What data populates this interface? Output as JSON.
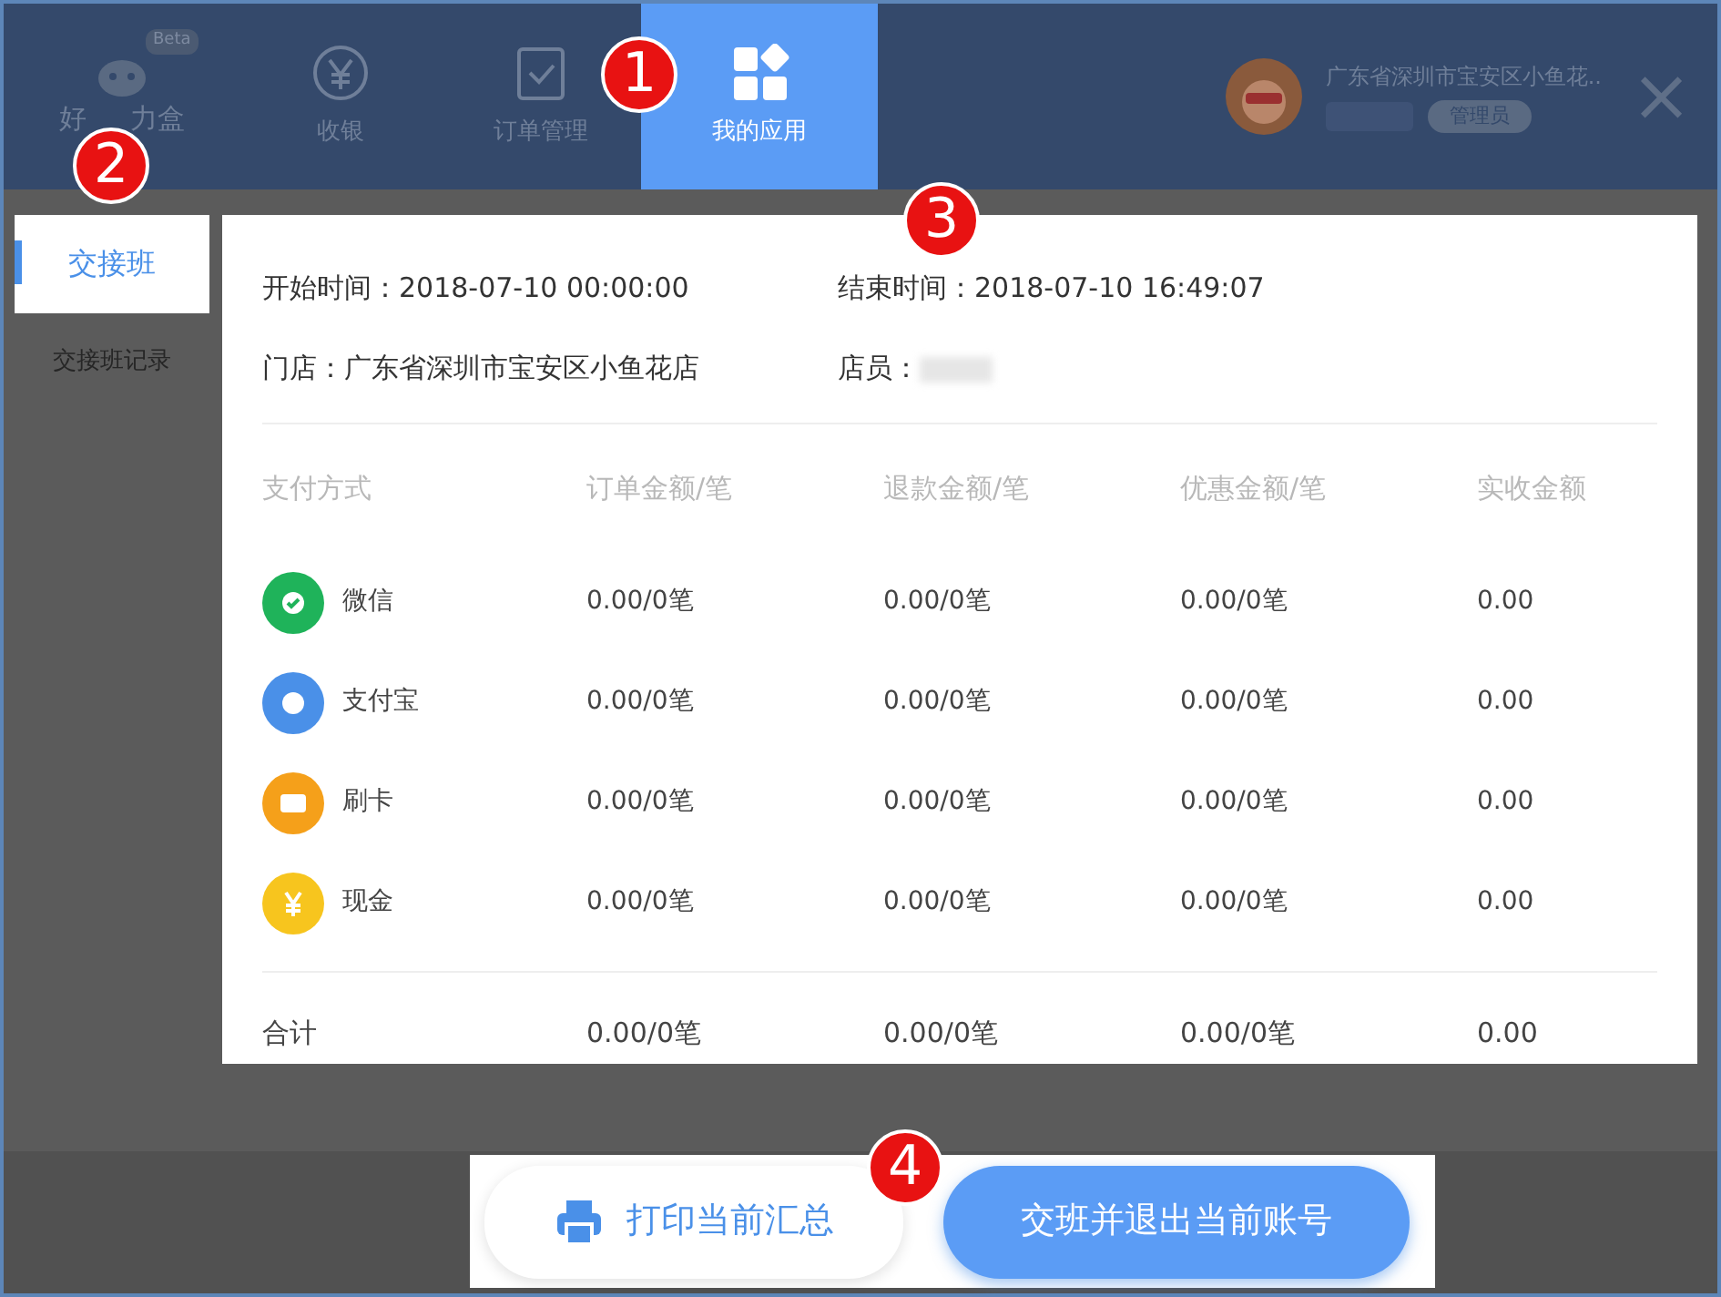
{
  "header": {
    "beta_badge": "Beta",
    "brand_parts": [
      "好",
      "力盒"
    ],
    "nav": [
      {
        "label": "收银",
        "selected": false
      },
      {
        "label": "订单管理",
        "selected": false
      },
      {
        "label": "我的应用",
        "selected": true
      }
    ],
    "store": "广东省深圳市宝安区小鱼花..",
    "role": "管理员",
    "close": "×"
  },
  "sidebar": {
    "items": [
      {
        "label": "交接班",
        "selected": true
      },
      {
        "label": "交接班记录",
        "selected": false
      }
    ]
  },
  "summary": {
    "start": "开始时间：2018-07-10 00:00:00",
    "end": "结束时间：2018-07-10 16:49:07",
    "store": "门店：广东省深圳市宝安区小鱼花店",
    "staff_label": "店员："
  },
  "table": {
    "columns": [
      "支付方式",
      "订单金额/笔",
      "退款金额/笔",
      "优惠金额/笔",
      "实收金额"
    ],
    "rows": [
      {
        "color": "#1fb35a",
        "cells": [
          "微信",
          "0.00/0笔",
          "0.00/0笔",
          "0.00/0笔",
          "0.00"
        ]
      },
      {
        "color": "#4a90e8",
        "cells": [
          "支付宝",
          "0.00/0笔",
          "0.00/0笔",
          "0.00/0笔",
          "0.00"
        ]
      },
      {
        "color": "#f5a01a",
        "cells": [
          "刷卡",
          "0.00/0笔",
          "0.00/0笔",
          "0.00/0笔",
          "0.00"
        ]
      },
      {
        "color": "#f7c51e",
        "cells": [
          "现金",
          "0.00/0笔",
          "0.00/0笔",
          "0.00/0笔",
          "0.00"
        ]
      },
      {
        "color": null,
        "cells": [
          "合计",
          "0.00/0笔",
          "0.00/0笔",
          "0.00/0笔",
          "0.00"
        ]
      }
    ]
  },
  "buttons": [
    {
      "label": "打印当前汇总",
      "kind": "print"
    },
    {
      "label": "交班并退出当前账号",
      "kind": "primary"
    }
  ],
  "annotations": [
    "1",
    "2",
    "3",
    "4"
  ]
}
